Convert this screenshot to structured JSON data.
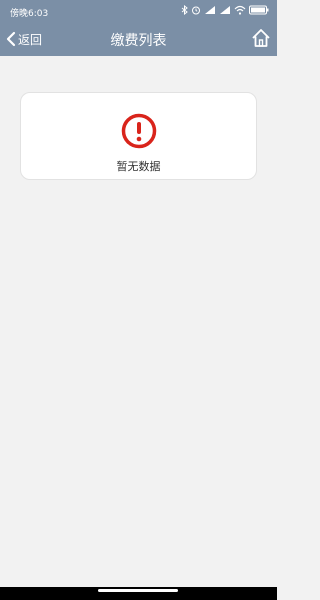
{
  "status_bar": {
    "time": "傍晚6:03",
    "battery": "100"
  },
  "nav": {
    "back_label": "返回",
    "title": "缴费列表"
  },
  "empty_state": {
    "message": "暂无数据"
  },
  "colors": {
    "header": "#7b8fa6",
    "alert": "#d9241b",
    "background": "#f2f2f2"
  },
  "icons": {
    "back": "chevron-left-icon",
    "home": "home-icon",
    "alert": "exclamation-circle-icon"
  }
}
